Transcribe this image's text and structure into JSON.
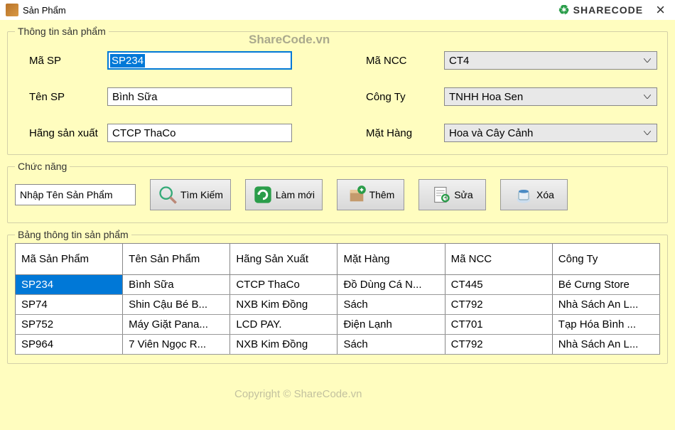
{
  "window": {
    "title": "Sản Phẩm"
  },
  "brand": "SHARECODE",
  "watermark1": "ShareCode.vn",
  "watermark2": "Copyright © ShareCode.vn",
  "info": {
    "legend": "Thông tin sản phẩm",
    "masp_label": "Mã SP",
    "masp_value": "SP234",
    "tensp_label": "Tên SP",
    "tensp_value": "Bình Sữa",
    "hang_label": "Hãng sản xuất",
    "hang_value": "CTCP ThaCo",
    "mancc_label": "Mã NCC",
    "mancc_value": "CT4",
    "congty_label": "Công Ty",
    "congty_value": "TNHH Hoa Sen",
    "mathang_label": "Mặt Hàng",
    "mathang_value": "Hoa và Cây Cảnh"
  },
  "func": {
    "legend": "Chức năng",
    "placeholder": "Nhập Tên Sản Phẩm",
    "timkiem": "Tìm Kiếm",
    "lammoi": "Làm mới",
    "them": "Thêm",
    "sua": "Sửa",
    "xoa": "Xóa"
  },
  "table": {
    "legend": "Bảng thông tin sản phẩm",
    "headers": [
      "Mã Sản Phẩm",
      "Tên Sản Phẩm",
      "Hãng Sản Xuất",
      "Mặt Hàng",
      "Mã NCC",
      "Công Ty"
    ],
    "rows": [
      [
        "SP234",
        "Bình Sữa",
        "CTCP ThaCo",
        "Đồ Dùng Cá N...",
        "CT445",
        "Bé Cưng Store"
      ],
      [
        "SP74",
        "Shin Cậu Bé B...",
        "NXB Kim Đồng",
        "Sách",
        "CT792",
        "Nhà Sách An L..."
      ],
      [
        "SP752",
        "Máy Giặt Pana...",
        "LCD PAY.",
        "Điện Lạnh",
        "CT701",
        "Tạp Hóa Bình ..."
      ],
      [
        "SP964",
        "7 Viên Ngọc R...",
        "NXB Kim Đồng",
        "Sách",
        "CT792",
        "Nhà Sách An L..."
      ]
    ]
  }
}
